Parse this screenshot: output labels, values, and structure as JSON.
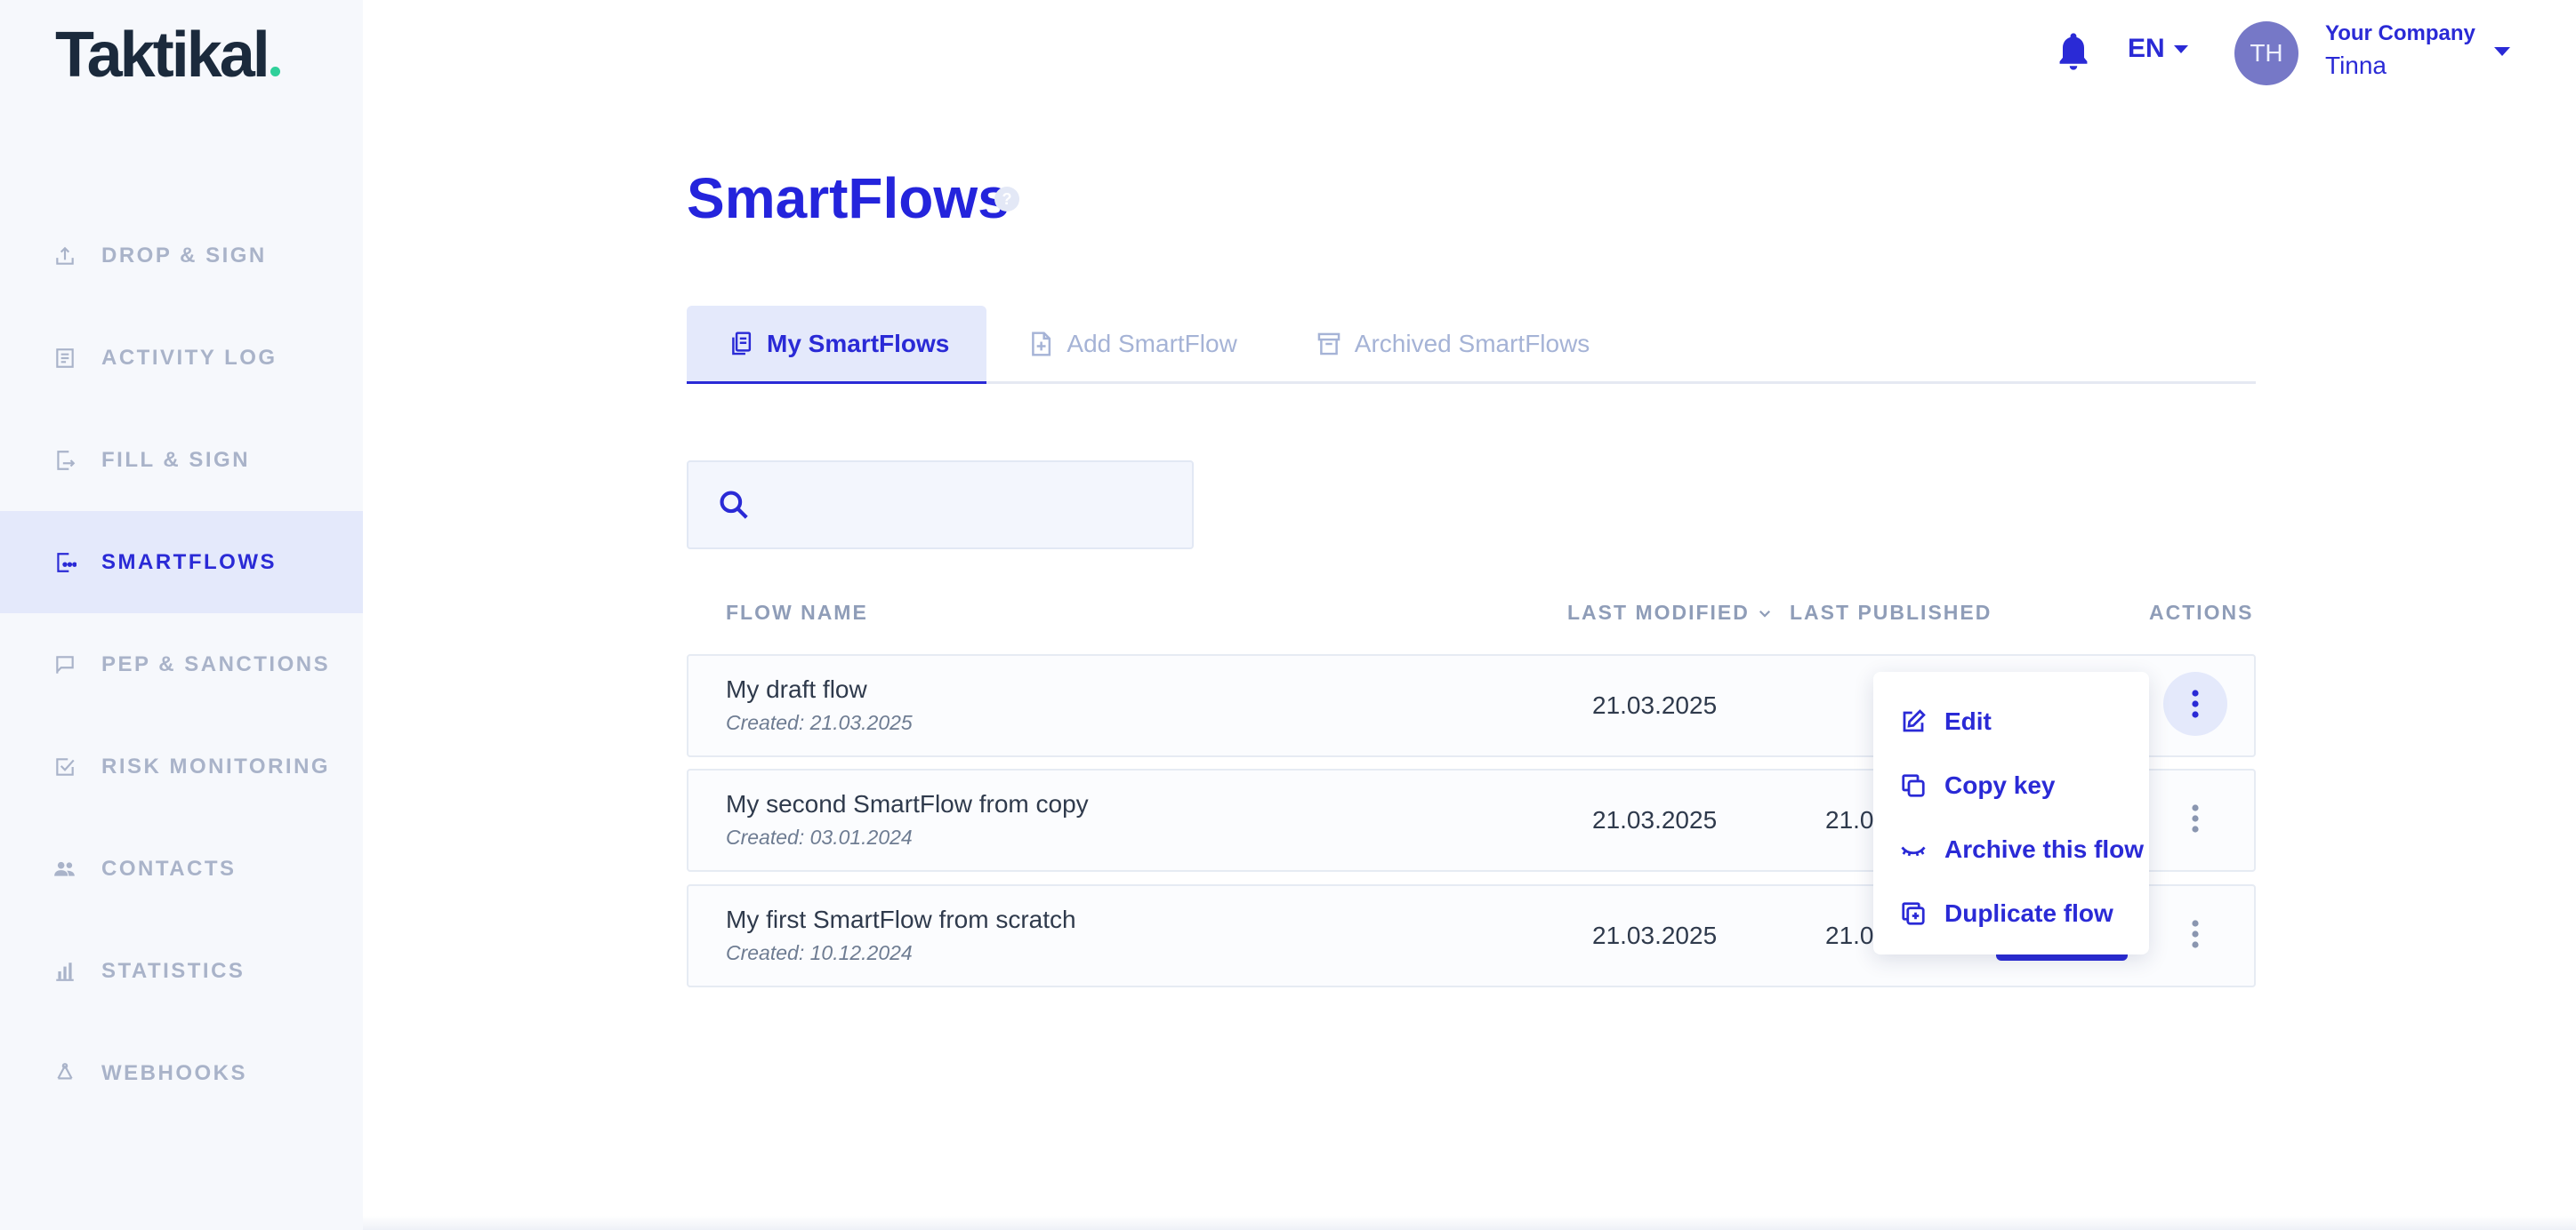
{
  "brand": {
    "logo_text": "Taktikal",
    "accent_dot_color": "#2fd09a"
  },
  "sidebar": {
    "items": [
      {
        "label": "DROP & SIGN",
        "icon": "upload-icon",
        "active": false
      },
      {
        "label": "ACTIVITY LOG",
        "icon": "log-icon",
        "active": false
      },
      {
        "label": "FILL & SIGN",
        "icon": "fill-sign-icon",
        "active": false
      },
      {
        "label": "SMARTFLOWS",
        "icon": "smartflow-icon",
        "active": true
      },
      {
        "label": "PEP & SANCTIONS",
        "icon": "flag-icon",
        "active": false
      },
      {
        "label": "RISK MONITORING",
        "icon": "check-square-icon",
        "active": false
      },
      {
        "label": "CONTACTS",
        "icon": "people-icon",
        "active": false
      },
      {
        "label": "STATISTICS",
        "icon": "bar-chart-icon",
        "active": false
      },
      {
        "label": "WEBHOOKS",
        "icon": "webhook-icon",
        "active": false
      }
    ]
  },
  "topbar": {
    "language": "EN",
    "user": {
      "initials": "TH",
      "company": "Your Company",
      "name": "Tinna"
    }
  },
  "page": {
    "title": "SmartFlows",
    "help_symbol": "?"
  },
  "tabs": [
    {
      "label": "My SmartFlows",
      "active": true
    },
    {
      "label": "Add SmartFlow",
      "active": false
    },
    {
      "label": "Archived SmartFlows",
      "active": false
    }
  ],
  "search": {
    "value": "",
    "placeholder": ""
  },
  "table": {
    "columns": {
      "flow_name": "FLOW NAME",
      "last_modified": "LAST MODIFIED",
      "last_published": "LAST PUBLISHED",
      "actions": "ACTIONS"
    },
    "rows": [
      {
        "name": "My draft flow",
        "created": "Created: 21.03.2025",
        "last_modified": "21.03.2025",
        "last_published": ""
      },
      {
        "name": "My second SmartFlow from copy",
        "created": "Created: 03.01.2024",
        "last_modified": "21.03.2025",
        "last_published": "21.03"
      },
      {
        "name": "My first SmartFlow from scratch",
        "created": "Created: 10.12.2024",
        "last_modified": "21.03.2025",
        "last_published": "21.03"
      }
    ]
  },
  "actions_menu": {
    "items": [
      {
        "label": "Edit",
        "icon": "pencil-icon"
      },
      {
        "label": "Copy key",
        "icon": "copy-icon"
      },
      {
        "label": "Archive this flow",
        "icon": "eye-closed-icon"
      },
      {
        "label": "Duplicate flow",
        "icon": "duplicate-icon"
      }
    ]
  },
  "colors": {
    "primary": "#2a2ad6",
    "sidebar_bg": "#f6f8fc",
    "active_bg": "#e4e9fb",
    "muted_text": "#a9b3c9"
  }
}
